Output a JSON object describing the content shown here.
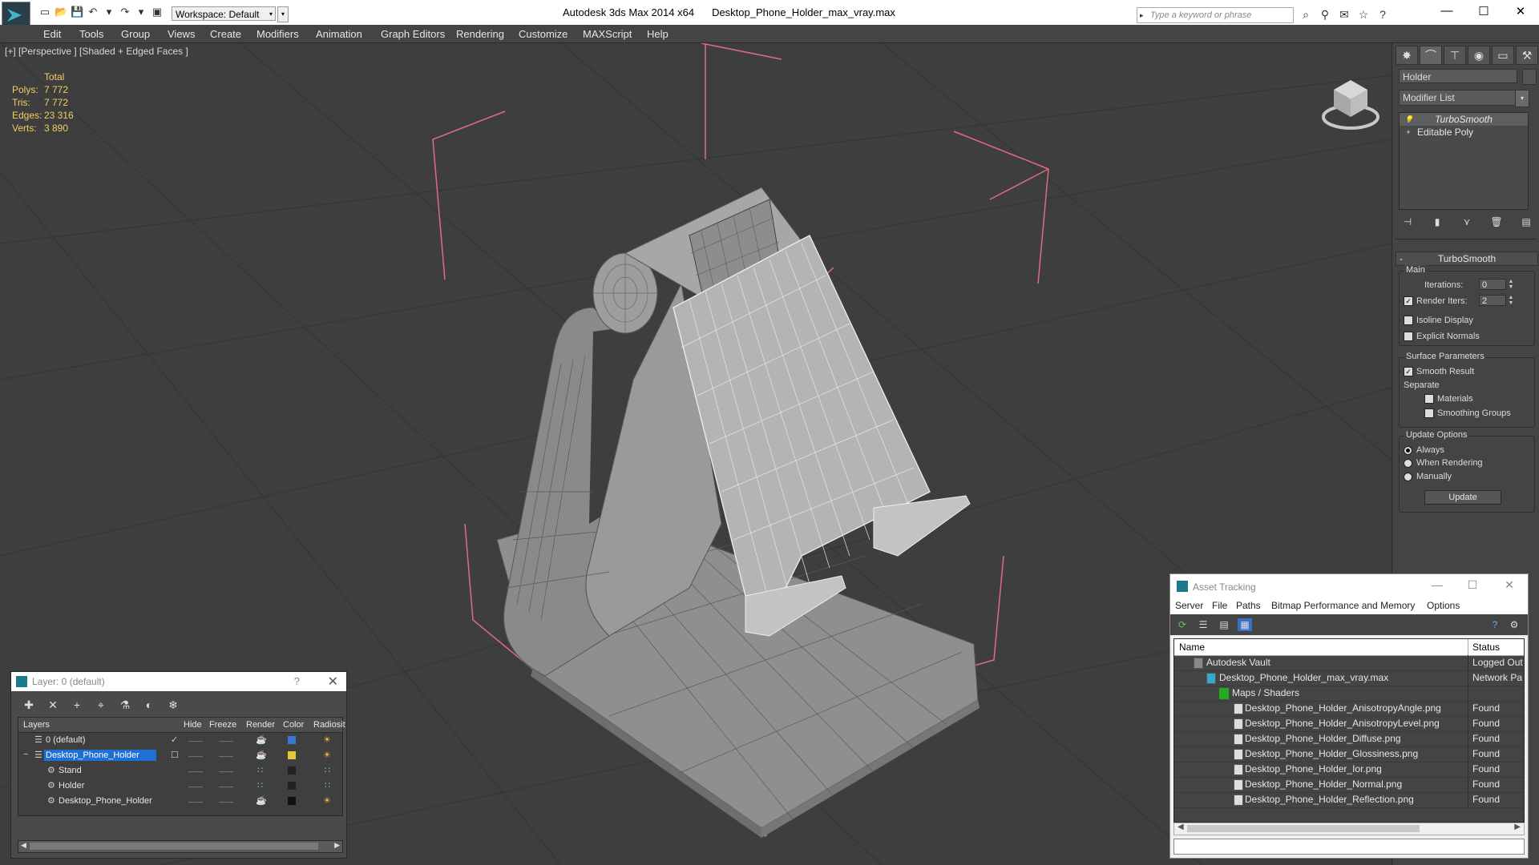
{
  "titlebar": {
    "app_name": "Autodesk 3ds Max  2014 x64",
    "file_name": "Desktop_Phone_Holder_max_vray.max",
    "workspace_label": "Workspace: Default",
    "search_placeholder": "Type a keyword or phrase",
    "minimize": "—",
    "maximize": "☐",
    "close": "✕"
  },
  "menu": [
    "Edit",
    "Tools",
    "Group",
    "Views",
    "Create",
    "Modifiers",
    "Animation",
    "Graph Editors",
    "Rendering",
    "Customize",
    "MAXScript",
    "Help"
  ],
  "viewport": {
    "label": "[+] [Perspective ] [Shaded + Edged Faces ]",
    "stats": {
      "header": "Total",
      "polys_label": "Polys:",
      "polys": "7 772",
      "tris_label": "Tris:",
      "tris": "7 772",
      "edges_label": "Edges:",
      "edges": "23 316",
      "verts_label": "Verts:",
      "verts": "3 890"
    }
  },
  "command_panel": {
    "object_name": "Holder",
    "modifier_list": "Modifier List",
    "stack": [
      {
        "label": "TurboSmooth",
        "selected": true
      },
      {
        "label": "Editable Poly",
        "selected": false
      }
    ],
    "rollout_title": "TurboSmooth",
    "rollout_collapse": "-",
    "main_group": "Main",
    "iterations_label": "Iterations:",
    "iterations_value": "0",
    "render_iters_label": "Render Iters:",
    "render_iters_value": "2",
    "isoline_label": "Isoline Display",
    "explicit_normals_label": "Explicit Normals",
    "surface_group": "Surface Parameters",
    "smooth_result_label": "Smooth Result",
    "separate_label": "Separate",
    "materials_label": "Materials",
    "smoothing_groups_label": "Smoothing Groups",
    "update_group": "Update Options",
    "always_label": "Always",
    "when_rendering_label": "When Rendering",
    "manually_label": "Manually",
    "update_button": "Update"
  },
  "layer_panel": {
    "title": "Layer: 0 (default)",
    "help": "?",
    "close": "✕",
    "columns": {
      "layers": "Layers",
      "hide": "Hide",
      "freeze": "Freeze",
      "render": "Render",
      "color": "Color",
      "radiosity": "Radiosit"
    },
    "rows": [
      {
        "name": "0 (default)",
        "color": "#3a78d6"
      },
      {
        "name": "Desktop_Phone_Holder",
        "color": "#e8c53a"
      },
      {
        "name": "Stand",
        "color": "#222222"
      },
      {
        "name": "Holder",
        "color": "#222222"
      },
      {
        "name": "Desktop_Phone_Holder",
        "color": "#111111"
      }
    ]
  },
  "asset_panel": {
    "title": "Asset Tracking",
    "menu": [
      "Server",
      "File",
      "Paths",
      "Bitmap Performance and Memory",
      "Options"
    ],
    "col_name": "Name",
    "col_status": "Status",
    "rows": [
      {
        "name": "Autodesk Vault",
        "status": "Logged Out"
      },
      {
        "name": "Desktop_Phone_Holder_max_vray.max",
        "status": "Network Pa"
      },
      {
        "name": "Maps / Shaders",
        "status": ""
      },
      {
        "name": "Desktop_Phone_Holder_AnisotropyAngle.png",
        "status": "Found"
      },
      {
        "name": "Desktop_Phone_Holder_AnisotropyLevel.png",
        "status": "Found"
      },
      {
        "name": "Desktop_Phone_Holder_Diffuse.png",
        "status": "Found"
      },
      {
        "name": "Desktop_Phone_Holder_Glossiness.png",
        "status": "Found"
      },
      {
        "name": "Desktop_Phone_Holder_Ior.png",
        "status": "Found"
      },
      {
        "name": "Desktop_Phone_Holder_Normal.png",
        "status": "Found"
      },
      {
        "name": "Desktop_Phone_Holder_Reflection.png",
        "status": "Found"
      }
    ]
  },
  "colors": {
    "accent_select": "#1e6fd6",
    "stats_text": "#eed060",
    "bbox_pink": "#e06a84"
  }
}
